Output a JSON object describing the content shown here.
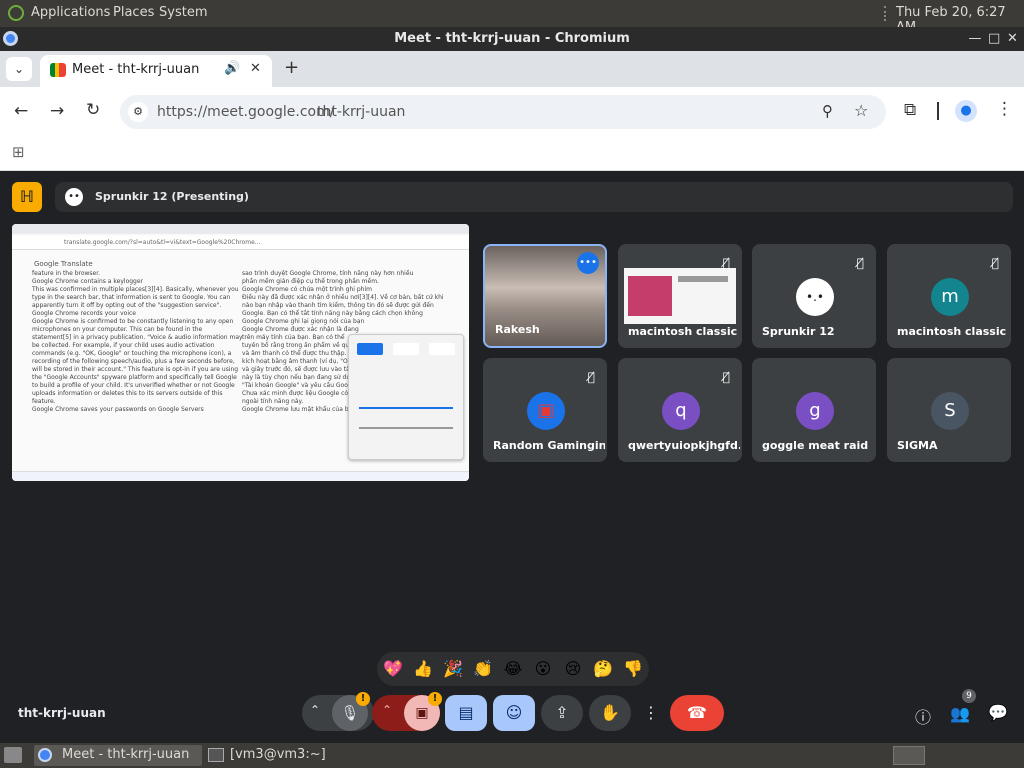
{
  "os": {
    "menus": [
      "Applications",
      "Places",
      "System"
    ],
    "datetime": "Thu Feb 20,  6:27 AM"
  },
  "window": {
    "title": "Meet - tht-krrj-uuan - Chromium"
  },
  "browser": {
    "tab_title": "Meet - tht-krrj-uuan",
    "url_host": "https://meet.google.com/",
    "url_path": "tht-krrj-uuan"
  },
  "meet": {
    "presenting_label": "Sprunkir 12 (Presenting)",
    "meeting_code": "tht-krrj-uuan",
    "people_count": "9",
    "participants": [
      {
        "name": "Rakesh",
        "type": "video"
      },
      {
        "name": "macintosh classic",
        "type": "screen"
      },
      {
        "name": "Sprunkir 12",
        "avatar": "•.•",
        "avatar_color": "#ffffff"
      },
      {
        "name": "macintosh classic 1",
        "avatar": "m",
        "avatar_color": "#12858f"
      },
      {
        "name": "Random Gamingin...",
        "avatar": "▣",
        "avatar_color": "#1a73e8"
      },
      {
        "name": "qwertyuiopkjhgfd...",
        "avatar": "q",
        "avatar_color": "#7b4fc4"
      },
      {
        "name": "goggle meat raid",
        "avatar": "g",
        "avatar_color": "#7b4fc4"
      },
      {
        "name": "SIGMA",
        "avatar": "S",
        "avatar_color": "#4a5563"
      }
    ],
    "reactions": [
      "💖",
      "👍",
      "🎉",
      "👏",
      "😂",
      "😮",
      "😢",
      "🤔",
      "👎"
    ]
  },
  "shared": {
    "heading": "Google Translate",
    "left_lines": [
      "feature in the browser.",
      "Google Chrome contains a keylogger",
      "This was confirmed in multiple places[3][4]. Basically, whenever you",
      "type in the search bar, that information is sent to Google. You can",
      "apparently turn it off by opting out of the \"suggestion service\".",
      "Google Chrome records your voice",
      "Google Chrome is confirmed to be constantly listening to any open",
      "microphones on your computer. This can be found in the",
      "statement[5] in a privacy publication. \"Voice & audio information may",
      "be collected. For example, if your child uses audio activation",
      "commands (e.g. \"OK, Google\" or touching the microphone icon), a",
      "recording of the following speech/audio, plus a few seconds before,",
      "will be stored in their account.\" This feature is opt-in if you are using",
      "the \"Google Accounts\" spyware platform and specifically tell Google",
      "to build a profile of your child. It's unverified whether or not Google",
      "uploads information or deletes this to its servers outside of this",
      "feature.",
      "Google Chrome saves your passwords on Google Servers"
    ],
    "right_lines": [
      "sao trình duyệt Google Chrome, tính năng này hơn nhiều",
      "phần mềm gián điệp cụ thể trong phần mềm.",
      "Google Chrome có chứa một trình ghi phím",
      "Điều này đã được xác nhận ở nhiều nơi[3][4]. Về cơ bản, bất cứ khi",
      "nào bạn nhập vào thanh tìm kiếm, thông tin đó sẽ được gửi đến",
      "Google. Bạn có thể tắt tính năng này bằng cách chọn không",
      "Google Chrome ghi lại giọng nói của bạn",
      "Google Chrome được xác nhận là đang",
      "trên máy tính của bạn. Bạn có thể",
      "tuyên bố rằng trong ấn phẩm về quyền",
      "và âm thanh có thể được thu thập.",
      "kích hoạt bằng âm thanh (ví dụ, \"OK,",
      "và giây trước đó, sẽ được lưu vào tài",
      "này là tùy chọn nếu bạn đang sử dụng",
      "\"Tài khoản Google\" và yêu cầu Google",
      "Chưa xác minh được liệu Google có tải",
      "ngoài tính năng này.",
      "Google Chrome lưu mật khẩu của bạn"
    ],
    "url": "translate.google.com/?sl=auto&tl=vi&text=Google%20Chrome..."
  }
}
